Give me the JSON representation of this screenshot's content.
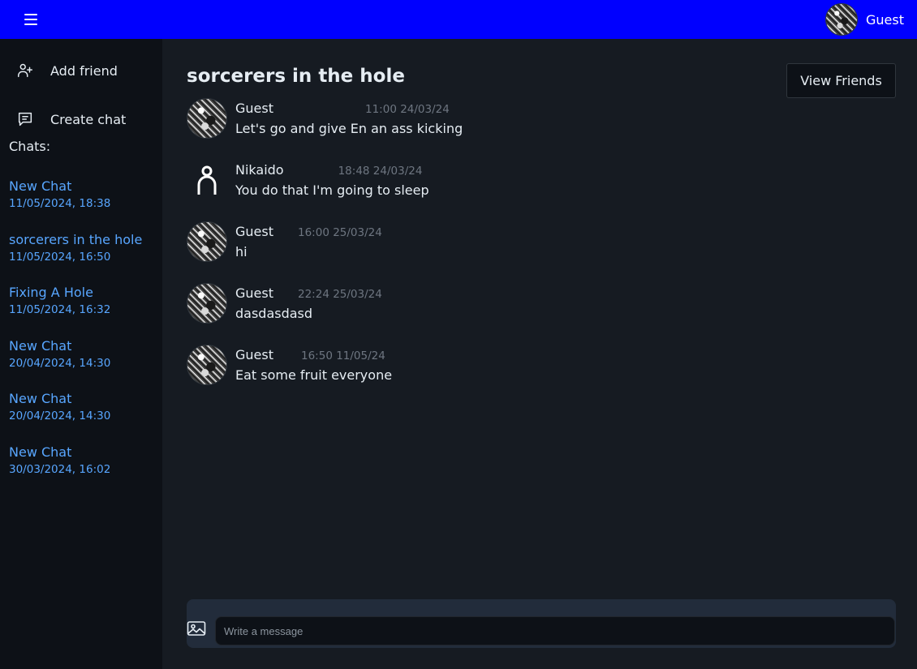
{
  "app": {
    "user_name": "Guest",
    "menu_icon": "hamburger-menu-icon"
  },
  "sidebar": {
    "actions": [
      {
        "label": "Add friend",
        "icon": "add-user-icon"
      },
      {
        "label": "Create chat",
        "icon": "chat-icon"
      }
    ],
    "chats_label": "Chats:",
    "chats": [
      {
        "name": "New Chat",
        "date": "11/05/2024, 18:38"
      },
      {
        "name": "sorcerers in the hole",
        "date": "11/05/2024, 16:50"
      },
      {
        "name": "Fixing A Hole",
        "date": "11/05/2024, 16:32"
      },
      {
        "name": "New Chat",
        "date": "20/04/2024, 14:30"
      },
      {
        "name": "New Chat",
        "date": "20/04/2024, 14:30"
      },
      {
        "name": "New Chat",
        "date": "30/03/2024, 16:02"
      }
    ]
  },
  "main": {
    "title": "sorcerers in the hole",
    "view_friends_label": "View Friends",
    "messages": [
      {
        "author": "Guest",
        "time": "11:00 24/03/24",
        "text": "Let's go and give En an ass kicking",
        "avatar": "photo"
      },
      {
        "author": "Nikaido",
        "time": "18:48 24/03/24",
        "text": "You do that I'm going to sleep",
        "avatar": "default-user-icon"
      },
      {
        "author": "Guest",
        "time": "16:00 25/03/24",
        "text": "hi",
        "avatar": "photo"
      },
      {
        "author": "Guest",
        "time": "22:24 25/03/24",
        "text": "dasdasdasd",
        "avatar": "photo"
      },
      {
        "author": "Guest",
        "time": "16:50 11/05/24",
        "text": "Eat some fruit everyone",
        "avatar": "photo"
      }
    ],
    "composer": {
      "placeholder": "Write a message",
      "image_icon": "image-icon"
    }
  },
  "colors": {
    "topbar": "#0000ff",
    "sidebar_bg": "#0d1117",
    "main_bg": "#161b22",
    "link": "#58a6ff",
    "timestamp": "#6e7681"
  }
}
